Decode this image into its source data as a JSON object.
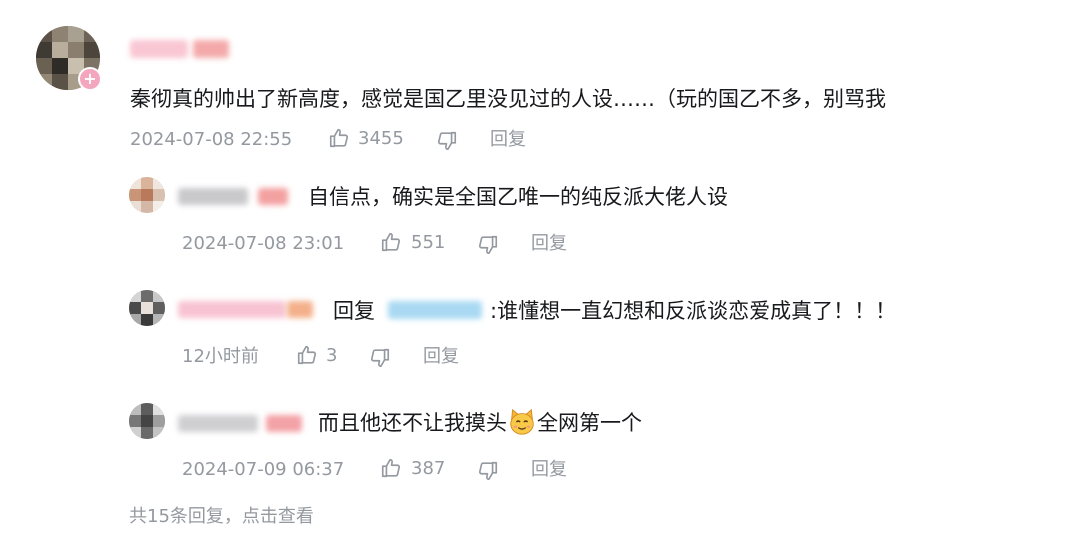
{
  "main_comment": {
    "text": "秦彻真的帅出了新高度，感觉是国乙里没见过的人设……（玩的国乙不多，别骂我",
    "time": "2024-07-08 22:55",
    "likes": "3455",
    "reply_label": "回复"
  },
  "replies": [
    {
      "text": "自信点，确实是全国乙唯一的纯反派大佬人设",
      "time": "2024-07-08 23:01",
      "likes": "551",
      "reply_label": "回复"
    },
    {
      "prefix": "回复",
      "text": ":谁懂想一直幻想和反派谈恋爱成真了！！！",
      "time": "12小时前",
      "likes": "3",
      "reply_label": "回复"
    },
    {
      "text_before": "而且他还不让我摸头",
      "text_after": "全网第一个",
      "emoji_name": "cat-face-icon",
      "time": "2024-07-09 06:37",
      "likes": "387",
      "reply_label": "回复"
    }
  ],
  "footer": {
    "summary": "共15条回复，点击查看"
  },
  "colors": {
    "text": "#18191c",
    "meta": "#9499a0",
    "name_pink": "#f9b9c9",
    "name_red": "#f28c8c",
    "mention_blue": "#9fd3ef"
  }
}
